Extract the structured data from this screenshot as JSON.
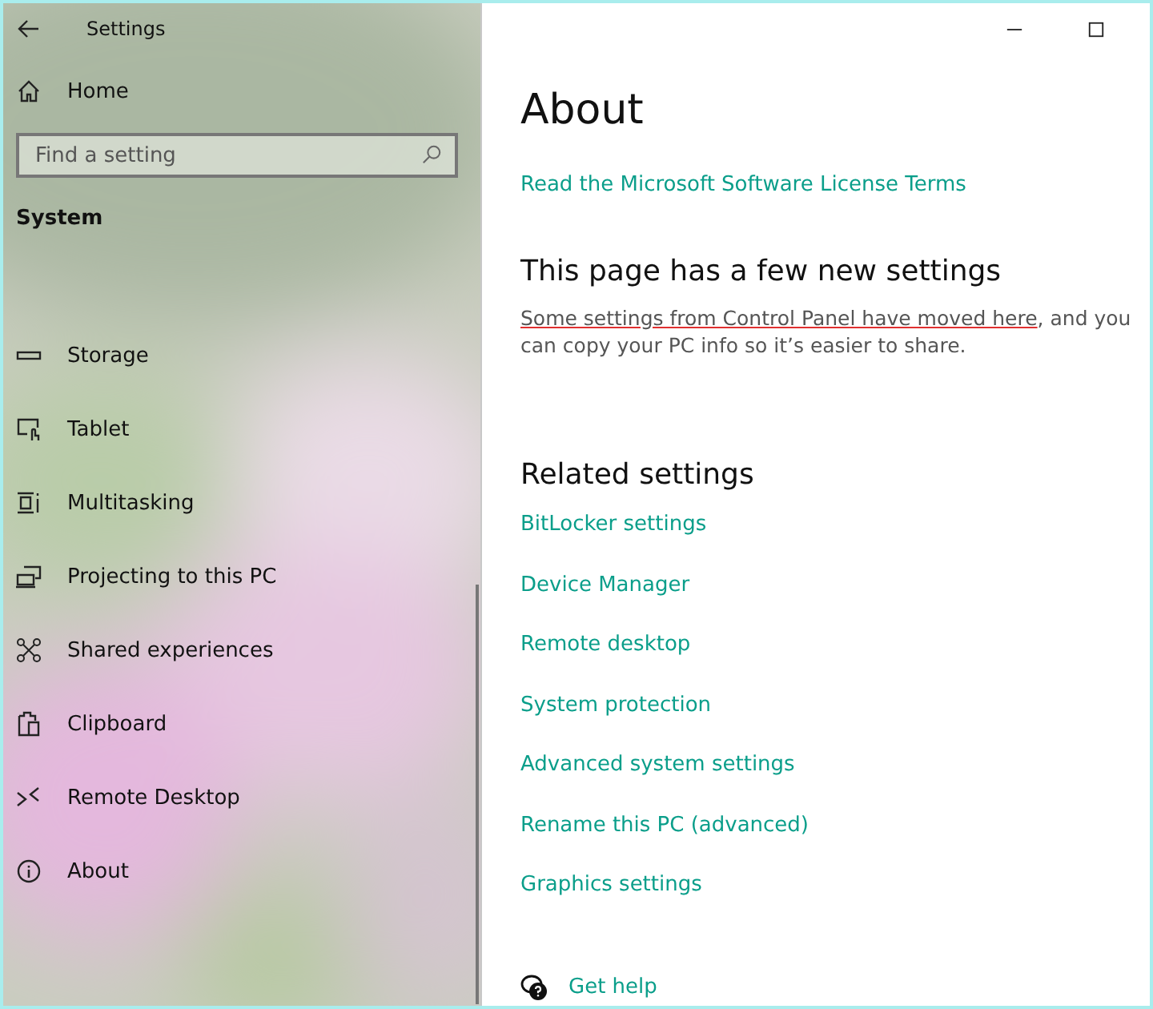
{
  "window": {
    "title": "Settings"
  },
  "sidebar": {
    "home": "Home",
    "search": {
      "placeholder": "Find a setting"
    },
    "section": "System",
    "items": [
      {
        "label": "Storage"
      },
      {
        "label": "Tablet"
      },
      {
        "label": "Multitasking"
      },
      {
        "label": "Projecting to this PC"
      },
      {
        "label": "Shared experiences"
      },
      {
        "label": "Clipboard"
      },
      {
        "label": "Remote Desktop"
      },
      {
        "label": "About"
      }
    ]
  },
  "page": {
    "title": "About",
    "license_link": "Read the Microsoft Software License Terms",
    "notice": {
      "heading": "This page has a few new settings",
      "link": "Some settings from Control Panel have moved here",
      "text": ", and you can copy your PC info so it’s easier to share."
    },
    "related": {
      "heading": "Related settings",
      "links": [
        "BitLocker settings",
        "Device Manager",
        "Remote desktop",
        "System protection",
        "Advanced system settings",
        "Rename this PC (advanced)",
        "Graphics settings"
      ]
    },
    "help": "Get help"
  }
}
